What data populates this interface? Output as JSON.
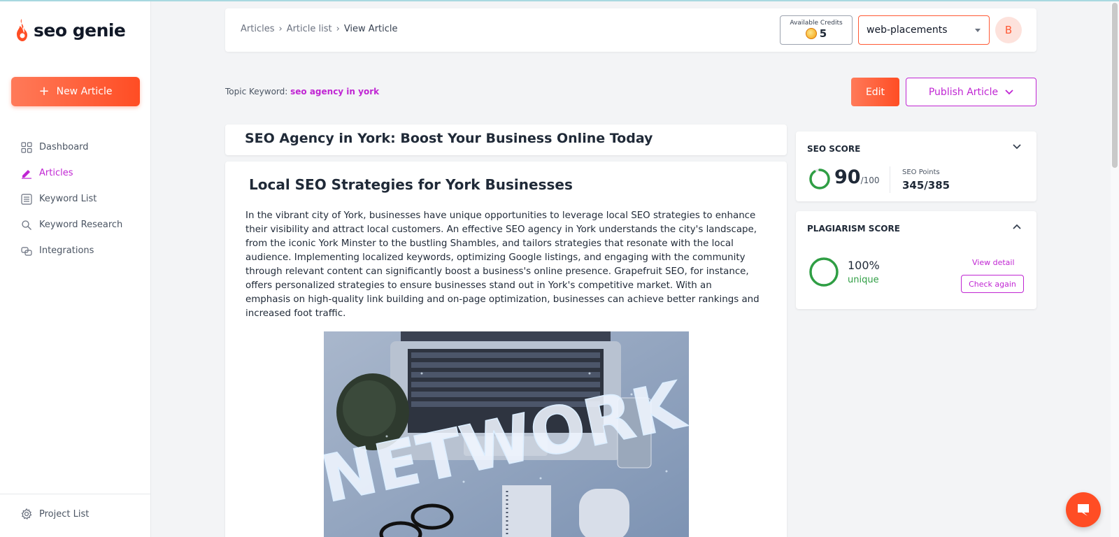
{
  "app": {
    "logo_text": "seo genie"
  },
  "sidebar": {
    "new_article_label": "New Article",
    "items": [
      {
        "label": "Dashboard",
        "icon": "dashboard-icon"
      },
      {
        "label": "Articles",
        "icon": "pencil-icon",
        "active": true
      },
      {
        "label": "Keyword List",
        "icon": "list-icon"
      },
      {
        "label": "Keyword Research",
        "icon": "search-icon"
      },
      {
        "label": "Integrations",
        "icon": "integrations-icon"
      }
    ],
    "project_list_label": "Project List"
  },
  "header": {
    "breadcrumb": [
      "Articles",
      "Article list",
      "View Article"
    ],
    "credits_label": "Available Credits",
    "credits_value": "5",
    "project_selected": "web-placements",
    "avatar_initial": "B"
  },
  "topic": {
    "label": "Topic Keyword:",
    "keyword": "seo agency in york"
  },
  "actions": {
    "edit_label": "Edit",
    "publish_label": "Publish Article"
  },
  "article": {
    "title": "SEO Agency in York: Boost Your Business Online Today",
    "section_heading": "Local SEO Strategies for York Businesses",
    "paragraph": "In the vibrant city of York, businesses have unique opportunities to leverage local SEO strategies to enhance their visibility and attract local customers. An effective SEO agency in York understands the city's landscape, from the iconic York Minster to the bustling Shambles, and tailors strategies that resonate with the local audience. Implementing localized keywords, optimizing Google listings, and engaging with the community through relevant content can significantly boost a business's online presence. Grapefruit SEO, for instance, offers personalized strategies to ensure businesses stand out in York's competitive market. With an emphasis on high-quality link building and on-page optimization, businesses can achieve better rankings and increased foot traffic.",
    "image_text": "NETWORK"
  },
  "seo_score": {
    "title": "SEO SCORE",
    "score": "90",
    "max": "/100",
    "points_label": "SEO Points",
    "points": "345/385",
    "fraction": 0.9
  },
  "plagiarism": {
    "title": "PLAGIARISM SCORE",
    "percent": "100%",
    "status": "unique",
    "view_detail_label": "View detail",
    "check_again_label": "Check again"
  },
  "colors": {
    "brand": "#ff4d24",
    "accent": "#c026d3",
    "success": "#2f9e44"
  }
}
